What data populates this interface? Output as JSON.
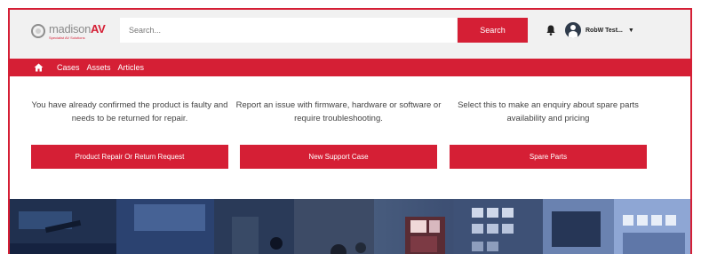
{
  "brand": {
    "logo_part1": "madison",
    "logo_part2": "AV",
    "tagline": "Specialist AV Solutions"
  },
  "header": {
    "search_placeholder": "Search...",
    "search_button": "Search",
    "user_name": "RobW Test..."
  },
  "nav": {
    "items": [
      {
        "label": "Cases"
      },
      {
        "label": "Assets"
      },
      {
        "label": "Articles"
      }
    ]
  },
  "tiles": [
    {
      "description": "You have already confirmed the product is faulty and needs to be returned for repair.",
      "button": "Product Repair Or Return Request"
    },
    {
      "description": "Report an issue with firmware, hardware or software or require troubleshooting.",
      "button": "New Support Case"
    },
    {
      "description": "Select this to make an enquiry about spare parts availability and pricing",
      "button": "Spare Parts"
    }
  ],
  "colors": {
    "accent": "#d51f35",
    "header_bg": "#f1f1f1"
  },
  "icons": {
    "notifications": "bell-icon",
    "home": "home-icon",
    "user_menu": "chevron-down-icon"
  }
}
